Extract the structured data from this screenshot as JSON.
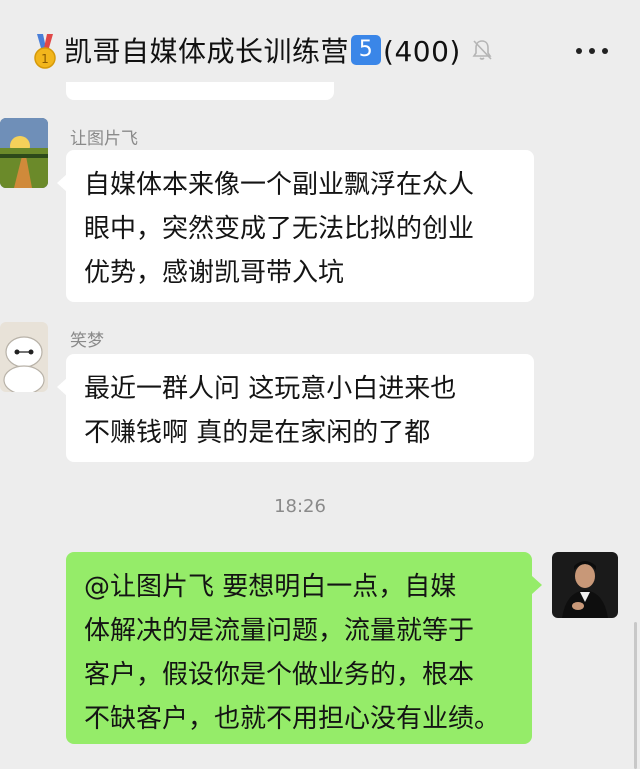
{
  "header": {
    "title": "凯哥自媒体成长训练营",
    "badge": "5",
    "count": "(400)",
    "medal_icon": "gold-medal-icon",
    "mute_icon": "bell-muted-icon",
    "more_icon": "more-dots-icon"
  },
  "messages": [
    {
      "sender": "让图片飞",
      "lines": [
        "自媒体本来像一个副业飘浮在众人",
        "眼中，突然变成了无法比拟的创业",
        "优势，感谢凯哥带入坑"
      ]
    },
    {
      "sender": "笑梦",
      "lines": [
        "最近一群人问   这玩意小白进来也",
        "不赚钱啊  真的是在家闲的了都"
      ]
    }
  ],
  "timestamp": "18:26",
  "my_message": {
    "lines": [
      "@让图片飞    要想明白一点，自媒",
      "体解决的是流量问题，流量就等于",
      "客户，假设你是个做业务的，根本",
      "不缺客户，也就不用担心没有业绩。"
    ]
  },
  "colors": {
    "background": "#ededed",
    "my_bubble": "#95ec69",
    "other_bubble": "#ffffff",
    "badge": "#3a86e8"
  }
}
